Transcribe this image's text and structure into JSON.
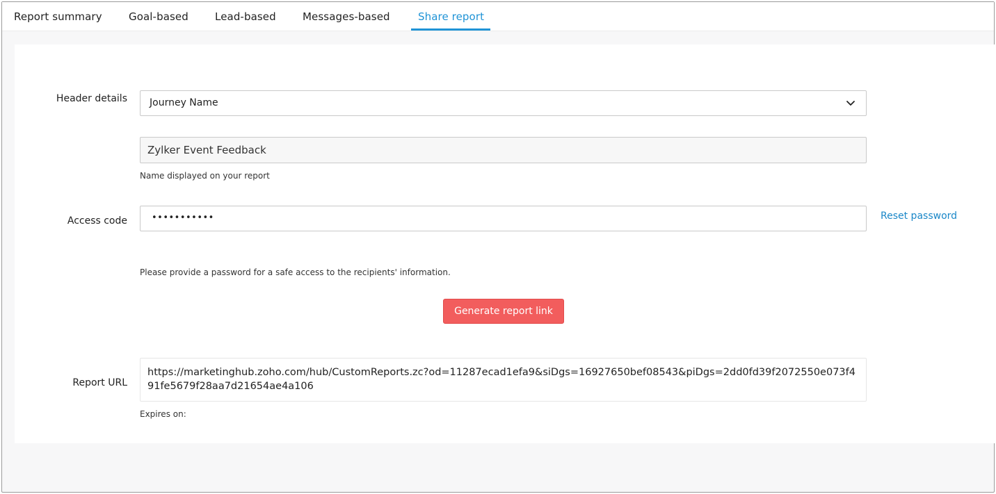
{
  "tabs": [
    {
      "label": "Report summary"
    },
    {
      "label": "Goal-based"
    },
    {
      "label": "Lead-based"
    },
    {
      "label": "Messages-based"
    },
    {
      "label": "Share report",
      "active": true
    }
  ],
  "header_details": {
    "label": "Header details",
    "selected": "Journey Name",
    "name_value": "Zylker Event Feedback",
    "name_hint": "Name displayed on your report"
  },
  "access_code": {
    "label": "Access code",
    "masked_value": "•••••••••••",
    "reset_label": "Reset password",
    "hint": "Please provide a password for a safe access to the recipients' information."
  },
  "generate_button": {
    "label": "Generate report link"
  },
  "report_url": {
    "label": "Report URL",
    "value": "https://marketinghub.zoho.com/hub/CustomReports.zc?od=11287ecad1efa9&siDgs=16927650bef08543&piDgs=2dd0fd39f2072550e073f491fe5679f28aa7d21654ae4a106",
    "expires_label": "Expires on:"
  },
  "colors": {
    "accent": "#1f93d6",
    "link": "#1a87c8",
    "button": "#f25d5d"
  }
}
